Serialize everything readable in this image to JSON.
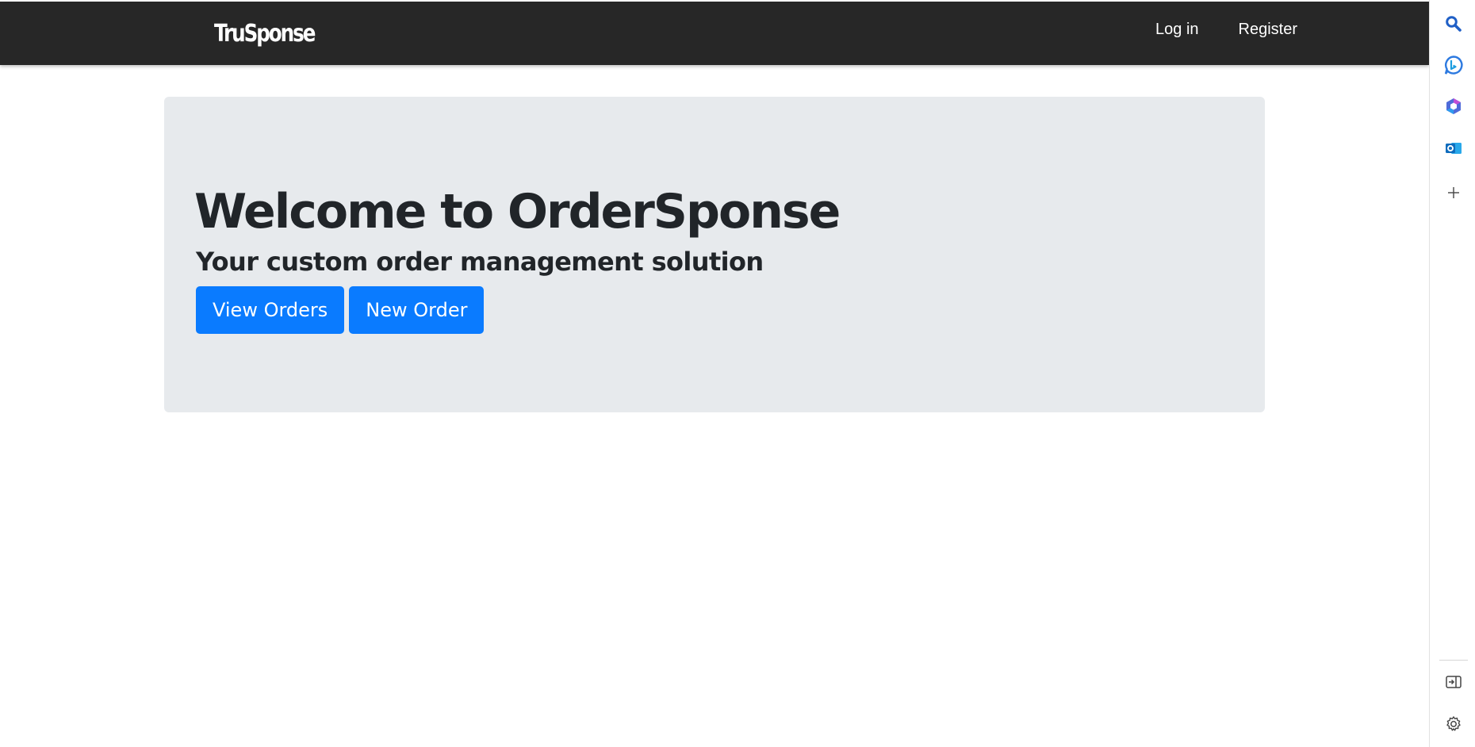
{
  "navbar": {
    "brand": "TruSponse",
    "links": [
      {
        "label": "Log in"
      },
      {
        "label": "Register"
      }
    ]
  },
  "hero": {
    "title": "Welcome to OrderSponse",
    "subtitle": "Your custom order management solution",
    "buttons": [
      {
        "label": "View Orders"
      },
      {
        "label": "New Order"
      }
    ]
  },
  "sidebar": {
    "icons": [
      "search-icon",
      "bing-chat-icon",
      "office-icon",
      "outlook-icon",
      "add-icon"
    ],
    "bottom_icons": [
      "hide-sidebar-icon",
      "settings-icon"
    ]
  },
  "colors": {
    "navbar_bg": "#272727",
    "hero_bg": "#e7eaed",
    "button_primary": "#0a7bff",
    "text_dark": "#212529"
  }
}
